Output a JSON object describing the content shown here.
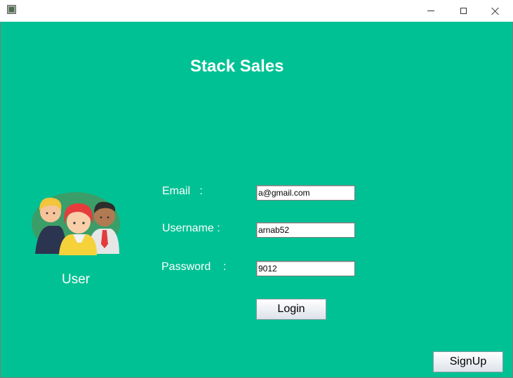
{
  "window": {
    "icon": "java-app-icon"
  },
  "title": "Stack Sales",
  "user": {
    "label": "User",
    "avatar_icon": "users-group-icon"
  },
  "form": {
    "email": {
      "label": "Email   :",
      "value": "a@gmail.com"
    },
    "username": {
      "label": "Username :",
      "value": "arnab52"
    },
    "password": {
      "label": "Password    :",
      "value": "9012"
    },
    "login_label": "Login"
  },
  "signup_label": "SignUp",
  "colors": {
    "background": "#00c194",
    "text": "#ffffff"
  }
}
